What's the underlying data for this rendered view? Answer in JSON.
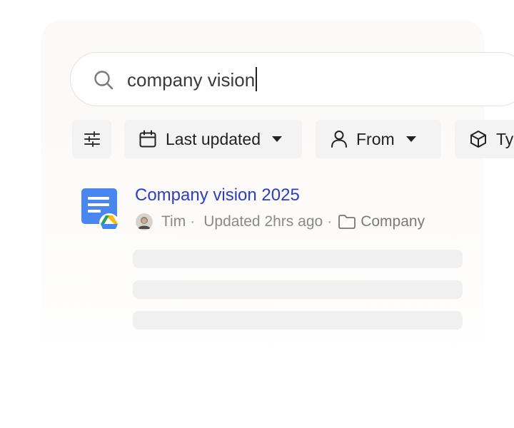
{
  "search": {
    "query": "company vision"
  },
  "filters": {
    "settings_icon": "sliders-icon",
    "last_updated_label": "Last updated",
    "from_label": "From",
    "type_label": "Ty"
  },
  "result": {
    "title": "Company vision 2025",
    "author": "Tim",
    "separator": "·",
    "updated": "Updated 2hrs ago",
    "folder": "Company",
    "doc_icon": "google-docs-icon",
    "source_icon": "google-drive-icon"
  },
  "colors": {
    "title_link": "#2c3bd1",
    "doc_blue": "#4a86f0"
  }
}
